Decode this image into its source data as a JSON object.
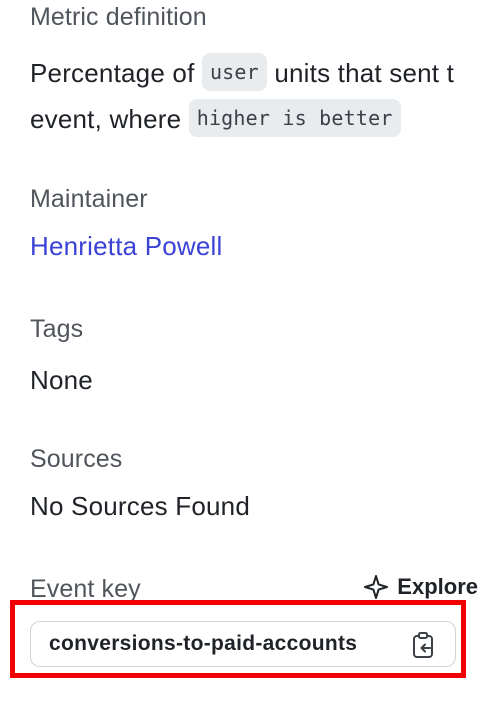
{
  "metric_definition": {
    "title": "Metric definition",
    "line1_prefix": "Percentage of",
    "line1_unit": "user",
    "line1_suffix": "units that sent t",
    "line2_prefix": "event, where",
    "line2_direction": "higher is better"
  },
  "maintainer": {
    "title": "Maintainer",
    "name": "Henrietta Powell"
  },
  "tags": {
    "title": "Tags",
    "value": "None"
  },
  "sources": {
    "title": "Sources",
    "value": "No Sources Found"
  },
  "event_key": {
    "title": "Event key",
    "explore_label": "Explore",
    "explore_icon": "sparkle-icon",
    "value": "conversions-to-paid-accounts",
    "copy_icon": "clipboard-copy-icon"
  },
  "colors": {
    "link": "#3b43d6",
    "highlight": "#f20000",
    "chip_bg": "#e9ecef"
  }
}
